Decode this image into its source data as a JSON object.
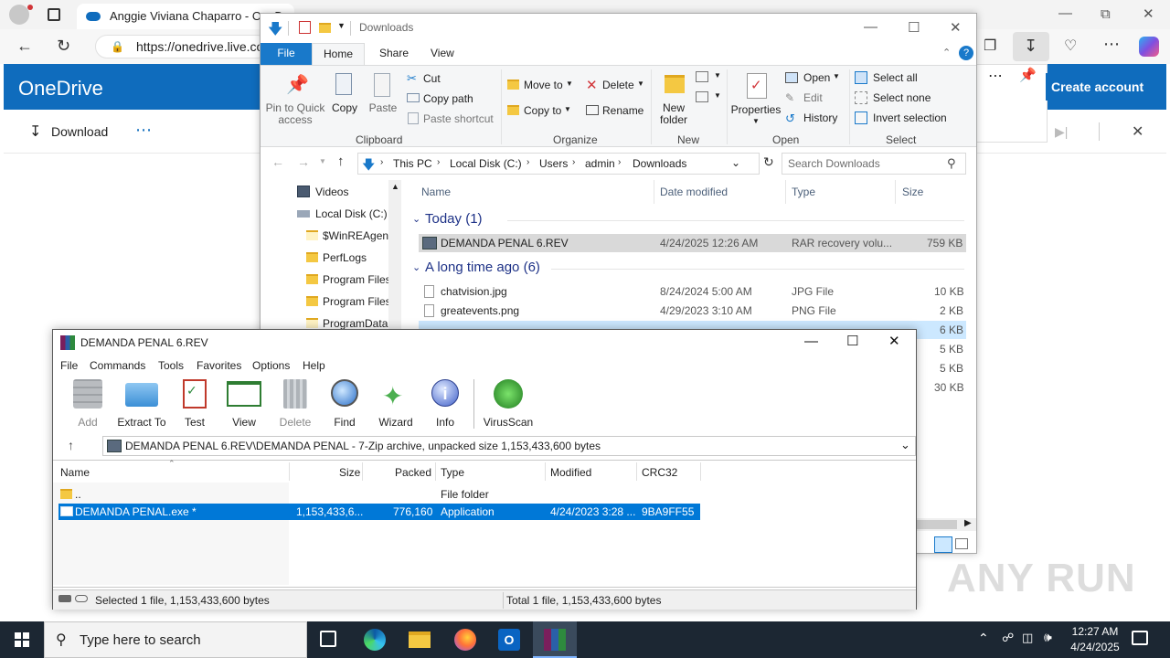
{
  "browser": {
    "tab_title": "Anggie Viviana Chaparro - OneDr",
    "url": "https://onedrive.live.co",
    "app_name": "OneDrive",
    "download_label": "Download",
    "create_account_label": "Create account"
  },
  "explorer": {
    "title": "Downloads",
    "tabs": [
      "File",
      "Home",
      "Share",
      "View"
    ],
    "clipboard": {
      "pin_label": "Pin to Quick access",
      "copy_label": "Copy",
      "paste_label": "Paste",
      "cut_label": "Cut",
      "copy_path_label": "Copy path",
      "paste_shortcut_label": "Paste shortcut",
      "group_label": "Clipboard"
    },
    "organize": {
      "move_to_label": "Move to",
      "copy_to_label": "Copy to",
      "delete_label": "Delete",
      "rename_label": "Rename",
      "group_label": "Organize"
    },
    "new": {
      "new_folder_label": "New folder",
      "group_label": "New"
    },
    "open": {
      "properties_label": "Properties",
      "open_label": "Open",
      "edit_label": "Edit",
      "history_label": "History",
      "group_label": "Open"
    },
    "select": {
      "select_all_label": "Select all",
      "select_none_label": "Select none",
      "invert_label": "Invert selection",
      "group_label": "Select"
    },
    "breadcrumb": [
      "This PC",
      "Local Disk (C:)",
      "Users",
      "admin",
      "Downloads"
    ],
    "search_placeholder": "Search Downloads",
    "nav_items": [
      "Videos",
      "Local Disk (C:)",
      "$WinREAgent",
      "PerfLogs",
      "Program Files",
      "Program Files",
      "ProgramData"
    ],
    "columns": [
      "Name",
      "Date modified",
      "Type",
      "Size"
    ],
    "groups": [
      {
        "label": "Today (1)",
        "files": [
          {
            "name": "DEMANDA PENAL 6.REV",
            "date": "4/24/2025 12:26 AM",
            "type": "RAR recovery volu...",
            "size": "759 KB"
          }
        ]
      },
      {
        "label": "A long time ago (6)",
        "files": [
          {
            "name": "chatvision.jpg",
            "date": "8/24/2024 5:00 AM",
            "type": "JPG File",
            "size": "10 KB"
          },
          {
            "name": "greatevents.png",
            "date": "4/29/2023 3:10 AM",
            "type": "PNG File",
            "size": "2 KB"
          },
          {
            "name": "",
            "date": "",
            "type": "",
            "size": "6 KB"
          },
          {
            "name": "",
            "date": "",
            "type": "",
            "size": "5 KB"
          },
          {
            "name": "",
            "date": "",
            "type": "",
            "size": "5 KB"
          },
          {
            "name": "",
            "date": "",
            "type": "",
            "size": "30 KB"
          }
        ]
      }
    ]
  },
  "winrar": {
    "title": "DEMANDA PENAL 6.REV",
    "menu": [
      "File",
      "Commands",
      "Tools",
      "Favorites",
      "Options",
      "Help"
    ],
    "tools": [
      "Add",
      "Extract To",
      "Test",
      "View",
      "Delete",
      "Find",
      "Wizard",
      "Info",
      "VirusScan"
    ],
    "path": "DEMANDA PENAL 6.REV\\DEMANDA PENAL - 7-Zip archive, unpacked size 1,153,433,600 bytes",
    "columns": [
      "Name",
      "Size",
      "Packed",
      "Type",
      "Modified",
      "CRC32"
    ],
    "rows": [
      {
        "name": "..",
        "size": "",
        "packed": "",
        "type": "File folder",
        "modified": "",
        "crc": ""
      },
      {
        "name": "DEMANDA PENAL.exe *",
        "size": "1,153,433,6...",
        "packed": "776,160",
        "type": "Application",
        "modified": "4/24/2023 3:28 ...",
        "crc": "9BA9FF55"
      }
    ],
    "status_left": "Selected 1 file, 1,153,433,600 bytes",
    "status_right": "Total 1 file, 1,153,433,600 bytes"
  },
  "taskbar": {
    "search_placeholder": "Type here to search",
    "time": "12:27 AM",
    "date": "4/24/2025"
  },
  "watermark": "ANY RUN",
  "colors": {
    "onedrive_blue": "#0f6cbd",
    "selection_blue": "#0078d7",
    "taskbar": "#1c2733"
  }
}
